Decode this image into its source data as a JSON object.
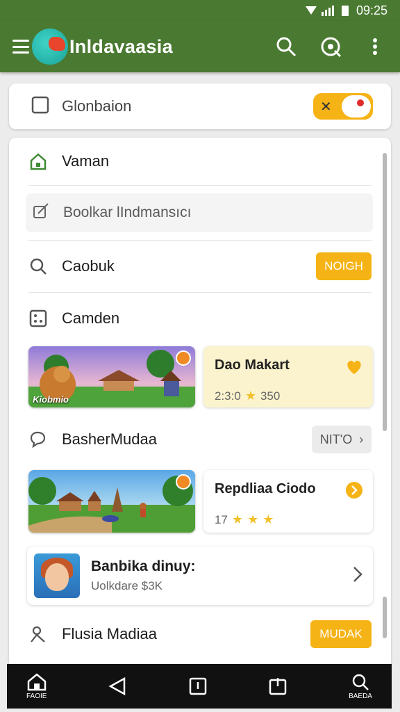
{
  "status": {
    "time": "09:25"
  },
  "app": {
    "title": "Inldavaasia"
  },
  "search_bar": {
    "label": "Glonbaion"
  },
  "menu": {
    "row1": {
      "label": "Vaman"
    },
    "field": {
      "placeholder": "Boolkar lIndmansıcı"
    },
    "row3": {
      "label": "Caobuk",
      "button": "NOIGH"
    },
    "row4": {
      "label": "Camden"
    }
  },
  "feature1": {
    "caption": "Kiobmio",
    "title": "Dao Makart",
    "rating": "2:3:0",
    "count": "350"
  },
  "row5": {
    "label": "BasherMudaa",
    "button": "NIT'O"
  },
  "feature2": {
    "title": "Repdliaa Ciodo",
    "rating": "17"
  },
  "list_card": {
    "title": "Banbika dinuy:",
    "subtitle": "Uolkdare $3K"
  },
  "row6": {
    "label": "Flusia Madiaa",
    "button": "MUDAK"
  },
  "navbar": {
    "home": "FAOIE",
    "search": "BAEDA"
  },
  "colors": {
    "primary": "#4a7a31",
    "accent": "#f6b316",
    "highlight": "#fbf3cd"
  },
  "icons": [
    "menu-icon",
    "search-icon",
    "settings-icon",
    "more-icon",
    "chat-icon",
    "home-icon",
    "edit-icon",
    "dice-icon",
    "heart-icon",
    "chevron-right-icon",
    "person-icon",
    "back-icon",
    "square-icon"
  ]
}
